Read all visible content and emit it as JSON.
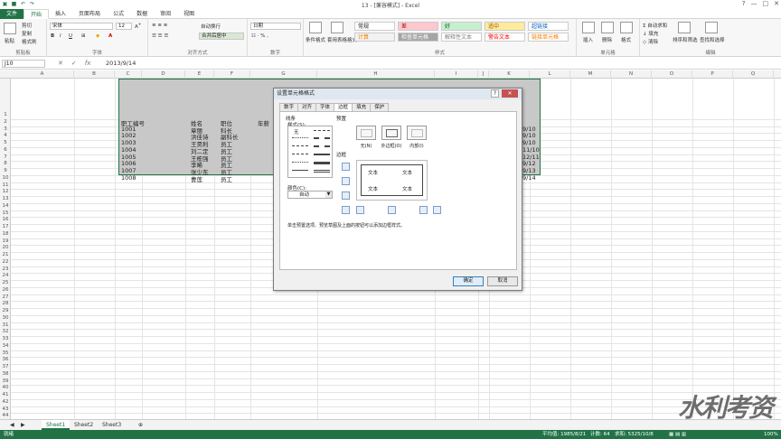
{
  "window": {
    "title": "13 - [兼容模式] - Excel",
    "controls": [
      "?",
      "—",
      "□",
      "✕"
    ]
  },
  "ribbon_tabs": [
    "文件",
    "开始",
    "插入",
    "页面布局",
    "公式",
    "数据",
    "审阅",
    "视图"
  ],
  "ribbon": {
    "clipboard": {
      "cut": "剪切",
      "copy": "复制",
      "format_painter": "格式刷",
      "paste": "粘贴",
      "label": "剪贴板"
    },
    "font": {
      "name": "宋体",
      "size": "12",
      "bold": "B",
      "italic": "I",
      "underline": "U",
      "label": "字体",
      "font_color": "A"
    },
    "alignment": {
      "wrap": "自动换行",
      "merge": "合并后居中",
      "label": "对齐方式"
    },
    "number": {
      "format": "日期",
      "label": "数字"
    },
    "styles": {
      "conditional": "条件格式",
      "as_table": "套用表格格式",
      "cells": [
        {
          "text": "常规",
          "bg": "#ffffff",
          "fg": "#222222"
        },
        {
          "text": "差",
          "bg": "#ffc7ce",
          "fg": "#9c0006"
        },
        {
          "text": "好",
          "bg": "#c6efce",
          "fg": "#006100"
        },
        {
          "text": "适中",
          "bg": "#ffeb9c",
          "fg": "#9c5700"
        },
        {
          "text": "超链接",
          "bg": "#ffffff",
          "fg": "#0563c1"
        },
        {
          "text": "计算",
          "bg": "#f2f2f2",
          "fg": "#fa7d00"
        },
        {
          "text": "检查单元格",
          "bg": "#a5a5a5",
          "fg": "#ffffff"
        },
        {
          "text": "解释性文本",
          "bg": "#ffffff",
          "fg": "#7f7f7f"
        },
        {
          "text": "警告文本",
          "bg": "#ffffff",
          "fg": "#ff0000"
        },
        {
          "text": "链接单元格",
          "bg": "#ffffff",
          "fg": "#fa7d00"
        }
      ],
      "label": "样式"
    },
    "cells_group": {
      "insert": "插入",
      "delete": "删除",
      "format": "格式",
      "label": "单元格"
    },
    "editing": {
      "autosum": "自动求和",
      "fill": "填充",
      "clear": "清除",
      "sort": "排序和筛选",
      "find": "查找和选择",
      "label": "编辑"
    }
  },
  "formula_bar": {
    "name_box": "J10",
    "value": "2013/9/14",
    "fx": "fx"
  },
  "columns": [
    "A",
    "B",
    "C",
    "D",
    "E",
    "F",
    "G",
    "H",
    "I",
    "J",
    "K",
    "L",
    "M",
    "N",
    "O",
    "P",
    "Q",
    "R"
  ],
  "rows": [
    "1",
    "2",
    "3",
    "4",
    "5",
    "6",
    "7",
    "8",
    "9",
    "10",
    "11",
    "12",
    "13",
    "14",
    "15",
    "16",
    "17",
    "18",
    "19",
    "20",
    "21",
    "22",
    "23",
    "24",
    "25",
    "26",
    "27",
    "28",
    "29",
    "30",
    "31",
    "32",
    "33",
    "34",
    "35",
    "36",
    "37",
    "38",
    "39",
    "40",
    "41",
    "42",
    "43",
    "44",
    "45",
    "46",
    "47"
  ],
  "sheet_table": {
    "headers": [
      "职工编号",
      "姓名",
      "职位",
      "年薪"
    ],
    "rows": [
      [
        "1001",
        "章丽",
        "科长"
      ],
      [
        "1002",
        "洪佳诗",
        "副科长"
      ],
      [
        "1003",
        "王昊利",
        "员工"
      ],
      [
        "1004",
        "刘二定",
        "员工"
      ],
      [
        "1005",
        "王栋强",
        "员工"
      ],
      [
        "1006",
        "李晞",
        "员工"
      ],
      [
        "1007",
        "张少东",
        "员工"
      ],
      [
        "1008",
        "曹莲",
        "员工"
      ]
    ],
    "j_column": [
      "9/10",
      "9/10",
      "9/10",
      "11/10",
      "12/11",
      "9/12",
      "9/13",
      "9/14"
    ]
  },
  "dialog": {
    "title": "设置单元格格式",
    "help": "?",
    "close": "✕",
    "tabs": [
      "数字",
      "对齐",
      "字体",
      "边框",
      "填充",
      "保护"
    ],
    "active_tab": "边框",
    "line_section": "线条",
    "style_label": "样式(S):",
    "none_label": "无",
    "color_label": "颜色(C):",
    "color_value": "自动",
    "presets_label": "预置",
    "presets": [
      "无(N)",
      "外边框(O)",
      "内部(I)"
    ],
    "border_label": "边框",
    "preview_text": [
      "文本",
      "文本",
      "文本",
      "文本"
    ],
    "hint": "单击预置选项、预览草图及上面的按钮可以添加边框样式。",
    "ok": "确定",
    "cancel": "取消"
  },
  "sheets": [
    "Sheet1",
    "Sheet2",
    "Sheet3"
  ],
  "active_sheet": "Sheet1",
  "status": {
    "mode": "就绪",
    "average": "平均值: 1985/8/21",
    "count": "计数: 64",
    "sum": "求和: 5325/10/8",
    "zoom": "100%"
  },
  "watermark": "水利考资"
}
